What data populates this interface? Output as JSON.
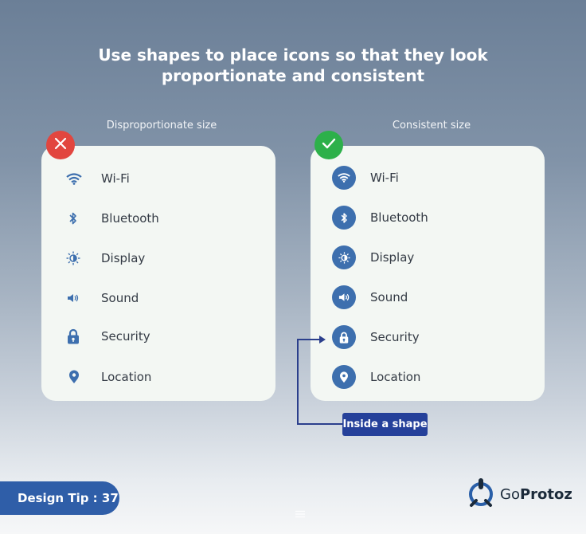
{
  "headline": {
    "line1": "Use shapes to place icons so that they look",
    "line2": "proportionate and consistent"
  },
  "left_panel": {
    "label": "Disproportionate size",
    "items": [
      {
        "label": "Wi-Fi",
        "icon": "wifi-icon"
      },
      {
        "label": "Bluetooth",
        "icon": "bluetooth-icon"
      },
      {
        "label": "Display",
        "icon": "brightness-icon"
      },
      {
        "label": "Sound",
        "icon": "speaker-icon"
      },
      {
        "label": "Security",
        "icon": "lock-icon"
      },
      {
        "label": "Location",
        "icon": "location-pin-icon"
      }
    ]
  },
  "right_panel": {
    "label": "Consistent size",
    "items": [
      {
        "label": "Wi-Fi",
        "icon": "wifi-icon"
      },
      {
        "label": "Bluetooth",
        "icon": "bluetooth-icon"
      },
      {
        "label": "Display",
        "icon": "brightness-icon"
      },
      {
        "label": "Sound",
        "icon": "speaker-icon"
      },
      {
        "label": "Security",
        "icon": "lock-icon"
      },
      {
        "label": "Location",
        "icon": "location-pin-icon"
      }
    ]
  },
  "callout": {
    "label": "Inside a shape"
  },
  "footer": {
    "tip": "Design Tip : 37",
    "brand_prefix": "Go",
    "brand_suffix": "Protoz"
  },
  "colors": {
    "icon_blue": "#3d6fae",
    "bad": "#e2463f",
    "good": "#2db04a",
    "callout": "#25409a",
    "pill": "#2f5ea8"
  }
}
